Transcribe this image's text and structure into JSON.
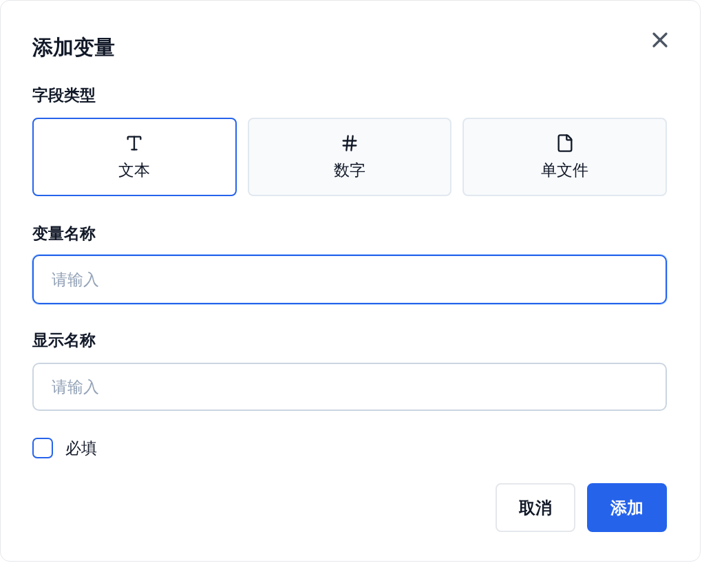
{
  "dialog": {
    "title": "添加变量"
  },
  "field_type": {
    "label": "字段类型",
    "options": [
      {
        "kind": "text",
        "label": "文本",
        "selected": true
      },
      {
        "kind": "number",
        "label": "数字",
        "selected": false
      },
      {
        "kind": "file",
        "label": "单文件",
        "selected": false
      }
    ]
  },
  "fields": [
    {
      "label": "变量名称",
      "placeholder": "请输入",
      "focused": true
    },
    {
      "label": "显示名称",
      "placeholder": "请输入",
      "focused": false
    }
  ],
  "required": {
    "label": "必填",
    "checked": false
  },
  "buttons": [
    {
      "kind": "secondary",
      "label": "取消"
    },
    {
      "kind": "primary",
      "label": "添加"
    }
  ]
}
